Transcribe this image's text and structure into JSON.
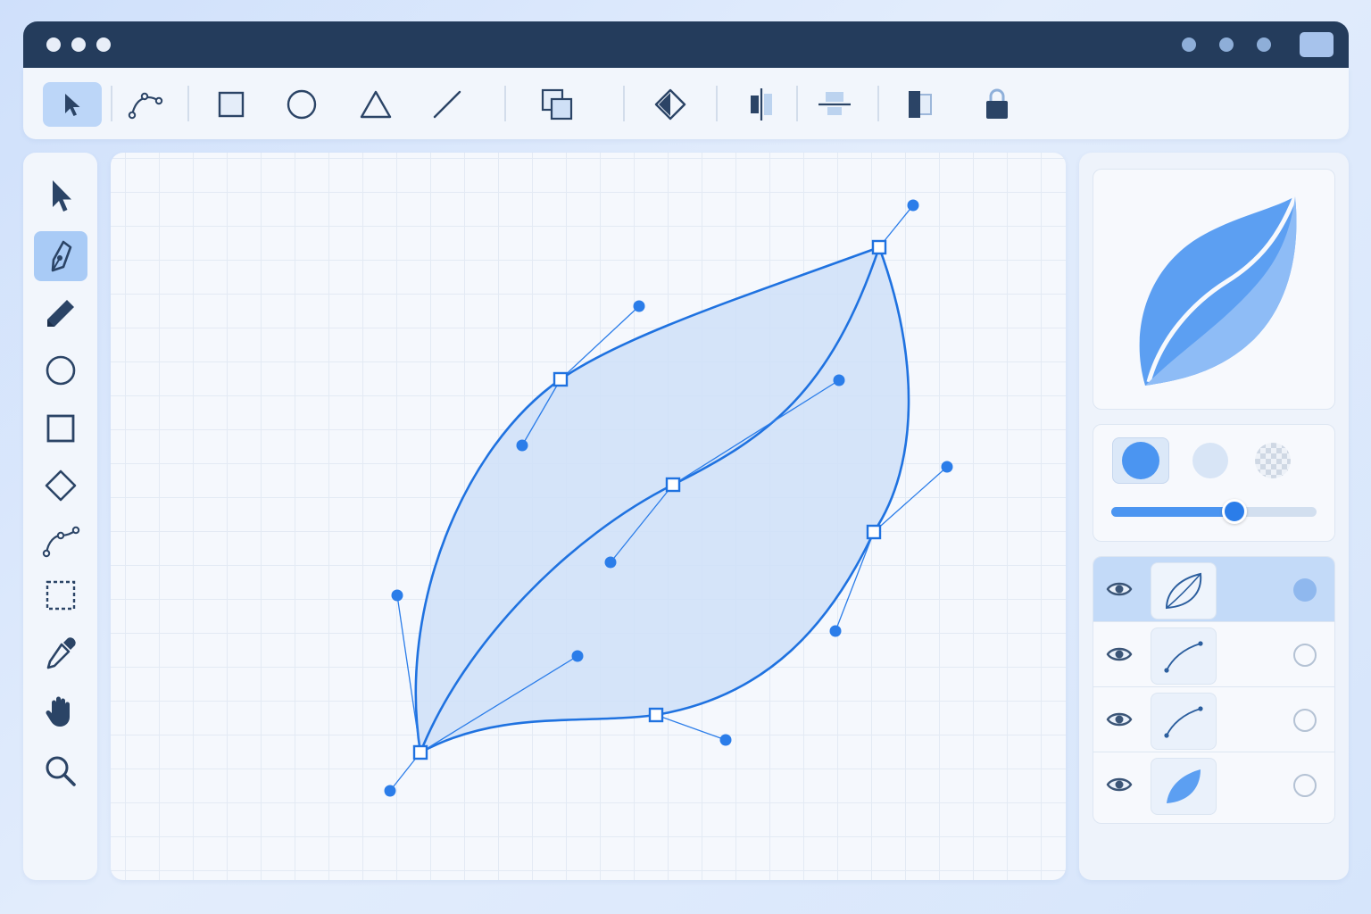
{
  "window": {
    "controls": [
      "close",
      "minimize",
      "maximize"
    ]
  },
  "toolbar": {
    "items": [
      {
        "id": "select",
        "icon": "cursor-icon",
        "active": true
      },
      {
        "id": "pen-curve",
        "icon": "bezier-curve-icon"
      },
      {
        "id": "rectangle",
        "icon": "square-icon"
      },
      {
        "id": "ellipse",
        "icon": "circle-icon"
      },
      {
        "id": "triangle",
        "icon": "triangle-icon"
      },
      {
        "id": "line",
        "icon": "line-icon"
      },
      {
        "id": "combine",
        "icon": "overlap-squares-icon"
      },
      {
        "id": "flip",
        "icon": "flip-diamond-icon"
      },
      {
        "id": "align-horizontal",
        "icon": "align-center-horizontal-icon"
      },
      {
        "id": "align-vertical",
        "icon": "align-center-vertical-icon"
      },
      {
        "id": "arrange",
        "icon": "arrange-front-icon"
      },
      {
        "id": "lock",
        "icon": "lock-icon"
      }
    ]
  },
  "tools": {
    "items": [
      {
        "id": "select",
        "icon": "cursor-icon"
      },
      {
        "id": "pen",
        "icon": "pen-nib-icon",
        "active": true
      },
      {
        "id": "pencil",
        "icon": "pencil-icon"
      },
      {
        "id": "ellipse",
        "icon": "circle-icon"
      },
      {
        "id": "rectangle",
        "icon": "square-icon"
      },
      {
        "id": "diamond",
        "icon": "diamond-icon"
      },
      {
        "id": "node",
        "icon": "node-path-icon"
      },
      {
        "id": "marquee",
        "icon": "dashed-selection-icon"
      },
      {
        "id": "eyedropper",
        "icon": "eyedropper-icon"
      },
      {
        "id": "hand",
        "icon": "hand-icon"
      },
      {
        "id": "zoom",
        "icon": "magnifier-icon"
      }
    ]
  },
  "colors": {
    "accent": "#1f72e0",
    "fill": "#cfe1f8",
    "anchor_stroke": "#1f72e0",
    "handle": "#2b7de9",
    "swatch_primary": "#4b95f1",
    "swatch_secondary": "#d8e5f6"
  },
  "appearance": {
    "opacity_fraction": 0.6
  },
  "layers": [
    {
      "thumb": "leaf-outline-icon",
      "visible": true,
      "selected": true
    },
    {
      "thumb": "curve-path-icon",
      "visible": true,
      "selected": false
    },
    {
      "thumb": "curve-path-icon",
      "visible": true,
      "selected": false
    },
    {
      "thumb": "leaf-filled-icon",
      "visible": true,
      "selected": false
    }
  ]
}
